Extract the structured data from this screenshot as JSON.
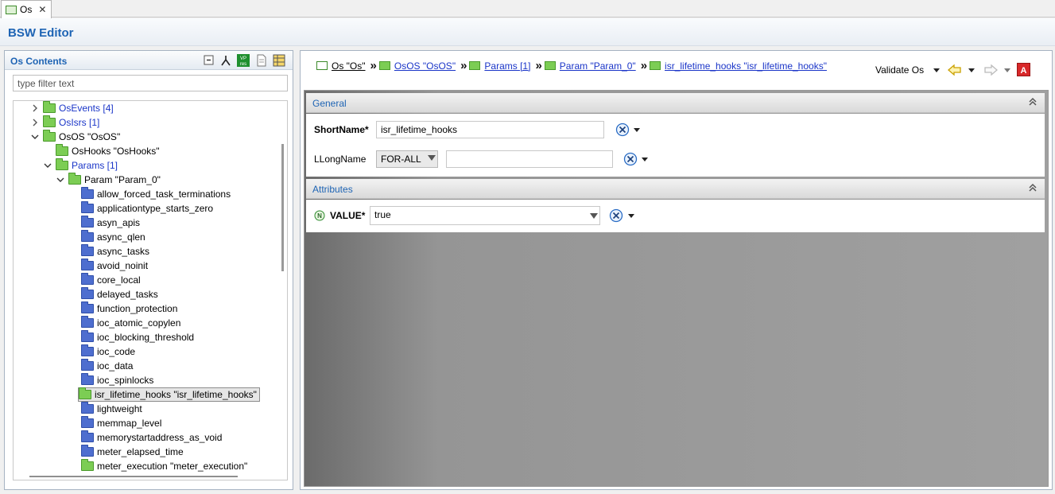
{
  "tab": {
    "label": "Os"
  },
  "editor": {
    "title": "BSW Editor"
  },
  "left": {
    "title": "Os Contents",
    "filter_placeholder": "type filter text",
    "tree": [
      {
        "label": "OsEvents [4]",
        "level": 1,
        "expander": "collapsed",
        "folder": "green",
        "link": true
      },
      {
        "label": "OsIsrs [1]",
        "level": 1,
        "expander": "collapsed",
        "folder": "green",
        "link": true
      },
      {
        "label": "OsOS \"OsOS\"",
        "level": 1,
        "expander": "expanded",
        "folder": "green",
        "link": false
      },
      {
        "label": "OsHooks \"OsHooks\"",
        "level": 2,
        "expander": "none",
        "folder": "green",
        "link": false
      },
      {
        "label": "Params [1]",
        "level": 2,
        "expander": "expanded",
        "folder": "green",
        "link": true
      },
      {
        "label": "Param \"Param_0\"",
        "level": 3,
        "expander": "expanded",
        "folder": "green",
        "link": false
      },
      {
        "label": "allow_forced_task_terminations",
        "level": 4,
        "expander": "none",
        "folder": "blue",
        "link": false
      },
      {
        "label": "applicationtype_starts_zero",
        "level": 4,
        "expander": "none",
        "folder": "blue",
        "link": false
      },
      {
        "label": "asyn_apis",
        "level": 4,
        "expander": "none",
        "folder": "blue",
        "link": false
      },
      {
        "label": "async_qlen",
        "level": 4,
        "expander": "none",
        "folder": "blue",
        "link": false
      },
      {
        "label": "async_tasks",
        "level": 4,
        "expander": "none",
        "folder": "blue",
        "link": false
      },
      {
        "label": "avoid_noinit",
        "level": 4,
        "expander": "none",
        "folder": "blue",
        "link": false
      },
      {
        "label": "core_local",
        "level": 4,
        "expander": "none",
        "folder": "blue",
        "link": false
      },
      {
        "label": "delayed_tasks",
        "level": 4,
        "expander": "none",
        "folder": "blue",
        "link": false
      },
      {
        "label": "function_protection",
        "level": 4,
        "expander": "none",
        "folder": "blue",
        "link": false
      },
      {
        "label": "ioc_atomic_copylen",
        "level": 4,
        "expander": "none",
        "folder": "blue",
        "link": false
      },
      {
        "label": "ioc_blocking_threshold",
        "level": 4,
        "expander": "none",
        "folder": "blue",
        "link": false
      },
      {
        "label": "ioc_code",
        "level": 4,
        "expander": "none",
        "folder": "blue",
        "link": false
      },
      {
        "label": "ioc_data",
        "level": 4,
        "expander": "none",
        "folder": "blue",
        "link": false
      },
      {
        "label": "ioc_spinlocks",
        "level": 4,
        "expander": "none",
        "folder": "blue",
        "link": false
      },
      {
        "label": "isr_lifetime_hooks \"isr_lifetime_hooks\"",
        "level": 4,
        "expander": "none",
        "folder": "green",
        "link": false,
        "selected": true
      },
      {
        "label": "lightweight",
        "level": 4,
        "expander": "none",
        "folder": "blue",
        "link": false
      },
      {
        "label": "memmap_level",
        "level": 4,
        "expander": "none",
        "folder": "blue",
        "link": false
      },
      {
        "label": "memorystartaddress_as_void",
        "level": 4,
        "expander": "none",
        "folder": "blue",
        "link": false
      },
      {
        "label": "meter_elapsed_time",
        "level": 4,
        "expander": "none",
        "folder": "blue",
        "link": false
      },
      {
        "label": "meter_execution \"meter_execution\"",
        "level": 4,
        "expander": "none",
        "folder": "green",
        "link": false
      }
    ]
  },
  "breadcrumb": [
    {
      "label": "Os \"Os\"",
      "icon": "white"
    },
    {
      "label": "OsOS \"OsOS\"",
      "icon": "green"
    },
    {
      "label": "Params [1]",
      "icon": "green"
    },
    {
      "label": "Param \"Param_0\"",
      "icon": "green"
    },
    {
      "label": "isr_lifetime_hooks \"isr_lifetime_hooks\"",
      "icon": "green"
    }
  ],
  "toolbar": {
    "validate_label": "Validate Os"
  },
  "general": {
    "title": "General",
    "shortname_label": "ShortName*",
    "shortname_value": "isr_lifetime_hooks",
    "longname_label": "LLongName",
    "language_value": "FOR-ALL",
    "longname_value": ""
  },
  "attributes": {
    "title": "Attributes",
    "value_label": "VALUE*",
    "value_value": "true",
    "value_badge": "N"
  },
  "colors": {
    "accent": "#1e64b4",
    "link": "#1a35c8",
    "green_folder": "#7ccd54",
    "blue_folder": "#4e6ecf"
  }
}
